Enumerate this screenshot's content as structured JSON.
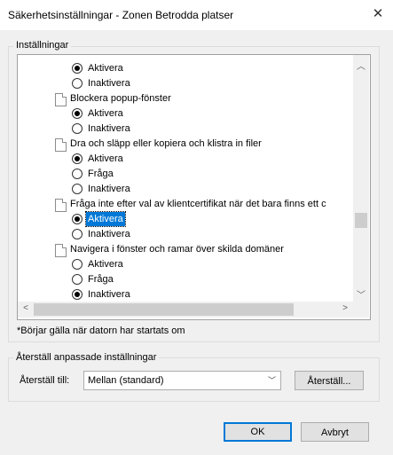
{
  "window": {
    "title": "Säkerhetsinställningar - Zonen Betrodda platser",
    "close_icon": "✕"
  },
  "settings_group": {
    "caption": "Inställningar",
    "rows": [
      {
        "kind": "radio",
        "label": "Aktivera",
        "checked": true
      },
      {
        "kind": "radio",
        "label": "Inaktivera",
        "checked": false
      },
      {
        "kind": "setting",
        "label": "Blockera popup-fönster"
      },
      {
        "kind": "radio",
        "label": "Aktivera",
        "checked": true
      },
      {
        "kind": "radio",
        "label": "Inaktivera",
        "checked": false
      },
      {
        "kind": "setting",
        "label": "Dra och släpp eller kopiera och klistra in filer"
      },
      {
        "kind": "radio",
        "label": "Aktivera",
        "checked": true
      },
      {
        "kind": "radio",
        "label": "Fråga",
        "checked": false
      },
      {
        "kind": "radio",
        "label": "Inaktivera",
        "checked": false
      },
      {
        "kind": "setting",
        "label": "Fråga inte efter val av klientcertifikat när det bara finns ett c"
      },
      {
        "kind": "radio",
        "label": "Aktivera",
        "checked": true,
        "selected": true
      },
      {
        "kind": "radio",
        "label": "Inaktivera",
        "checked": false
      },
      {
        "kind": "setting",
        "label": "Navigera i fönster och ramar över skilda domäner"
      },
      {
        "kind": "radio",
        "label": "Aktivera",
        "checked": false
      },
      {
        "kind": "radio",
        "label": "Fråga",
        "checked": false
      },
      {
        "kind": "radio",
        "label": "Inaktivera",
        "checked": true
      }
    ],
    "scroll_up_icon": "︿",
    "scroll_down_icon": "﹀",
    "scroll_left_icon": "<",
    "scroll_right_icon": ">",
    "footnote": "*Börjar gälla när datorn har startats om"
  },
  "reset_group": {
    "caption": "Återställ anpassade inställningar",
    "reset_to_label": "Återställ till:",
    "selected_level": "Mellan (standard)",
    "chevron_icon": "﹀",
    "reset_button": "Återställ..."
  },
  "footer": {
    "ok": "OK",
    "cancel": "Avbryt"
  },
  "colors": {
    "selection": "#0078d7",
    "default_button_border": "#0078d7"
  }
}
